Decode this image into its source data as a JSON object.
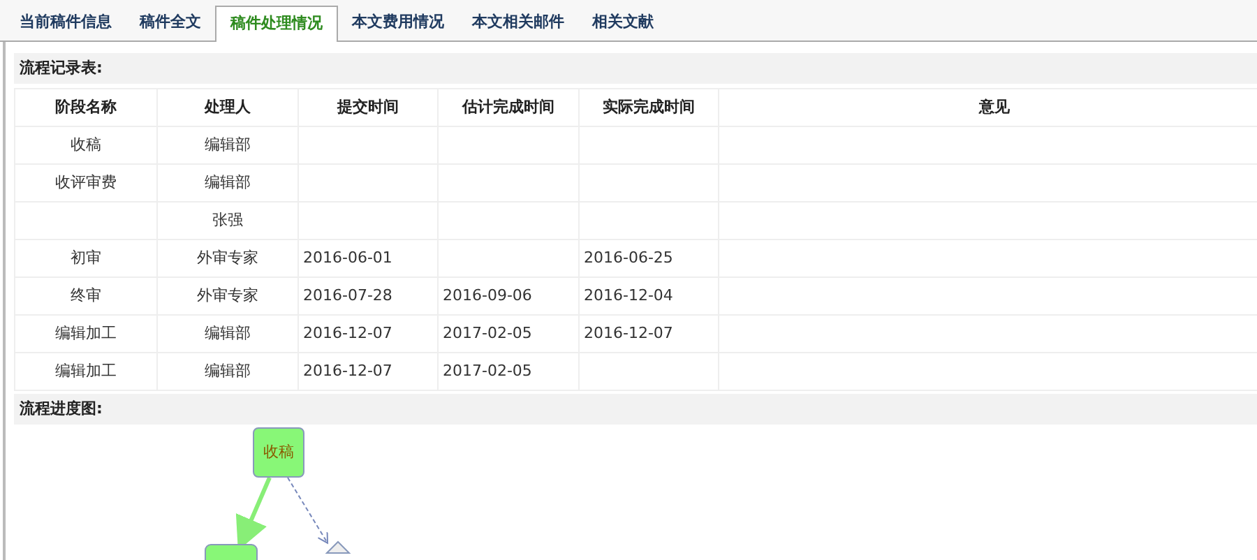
{
  "tabs": [
    {
      "label": "当前稿件信息",
      "selected": false
    },
    {
      "label": "稿件全文",
      "selected": false
    },
    {
      "label": "稿件处理情况",
      "selected": true
    },
    {
      "label": "本文费用情况",
      "selected": false
    },
    {
      "label": "本文相关邮件",
      "selected": false
    },
    {
      "label": "相关文献",
      "selected": false
    }
  ],
  "record_section": {
    "title": "流程记录表:"
  },
  "table": {
    "columns": [
      "阶段名称",
      "处理人",
      "提交时间",
      "估计完成时间",
      "实际完成时间",
      "意见"
    ],
    "rows": [
      [
        "收稿",
        "编辑部",
        "",
        "",
        "",
        ""
      ],
      [
        "收评审费",
        "编辑部",
        "",
        "",
        "",
        ""
      ],
      [
        "",
        "张强",
        "",
        "",
        "",
        ""
      ],
      [
        "初审",
        "外审专家",
        "2016-06-01",
        "",
        "2016-06-25",
        ""
      ],
      [
        "终审",
        "外审专家",
        "2016-07-28",
        "2016-09-06",
        "2016-12-04",
        ""
      ],
      [
        "编辑加工",
        "编辑部",
        "2016-12-07",
        "2017-02-05",
        "2016-12-07",
        ""
      ],
      [
        "编辑加工",
        "编辑部",
        "2016-12-07",
        "2017-02-05",
        "",
        ""
      ]
    ]
  },
  "progress_section": {
    "title": "流程进度图:",
    "nodes": [
      {
        "label": "收稿"
      }
    ]
  }
}
